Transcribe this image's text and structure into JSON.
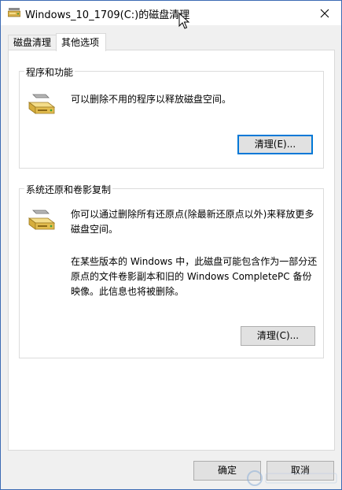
{
  "window": {
    "title": "Windows_10_1709(C:)的磁盘清理"
  },
  "tabs": [
    {
      "label": "磁盘清理",
      "selected": false
    },
    {
      "label": "其他选项",
      "selected": true
    }
  ],
  "programs_group": {
    "legend": "程序和功能",
    "description": "可以删除不用的程序以释放磁盘空间。",
    "button_label": "清理(E)..."
  },
  "restore_group": {
    "legend": "系统还原和卷影复制",
    "description_1": "你可以通过删除所有还原点(除最新还原点以外)来释放更多磁盘空间。",
    "description_2": "在某些版本的 Windows 中，此磁盘可能包含作为一部分还原点的文件卷影副本和旧的 Windows CompletePC 备份映像。此信息也将被删除。",
    "button_label": "清理(C)..."
  },
  "footer": {
    "ok_label": "确定",
    "cancel_label": "取消"
  },
  "colors": {
    "accent": "#0078d7",
    "window_border": "#3c6bb4",
    "button_face": "#e1e1e1"
  },
  "icons": {
    "app": "disk-cleanup-icon",
    "drive": "hard-drive-icon",
    "close": "close-icon"
  }
}
